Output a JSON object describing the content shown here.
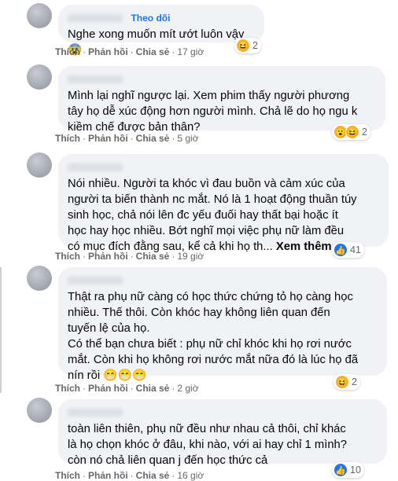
{
  "comments": [
    {
      "follow_label": "Theo dõi",
      "text": "Nghe xong muốn mít ướt luôn vậy 😨",
      "actions": {
        "like": "Thích",
        "reply": "Phản hồi",
        "share": "Chia sẻ",
        "time": "17 giờ"
      },
      "reactions": {
        "icons": [
          "haha-icon"
        ],
        "count": "2"
      }
    },
    {
      "text": "Mình lại nghĩ ngược lại. Xem phim thấy người phương\ntây họ dễ xúc động hơn người mình. Chả lẽ do họ ngu k\nkiềm chế được bản thân?",
      "actions": {
        "like": "Thích",
        "reply": "Phản hồi",
        "share": "Chia sẻ",
        "time": "5 giờ"
      },
      "reactions": {
        "icons": [
          "wow-icon",
          "haha-icon"
        ],
        "count": "2"
      }
    },
    {
      "text": "Nói nhiều. Người ta khóc vì đau buồn và cảm xúc của\nngười ta biến thành nc mắt. Nó là 1 hoạt động thuần túy\nsinh học, chả nói lên đc yếu đuối hay thất bại hoặc ít\nhọc hay học nhiều. Bớt nghĩ mọi việc phụ nữ làm đều\ncó mục đích đằng sau, kể cả khi họ th...",
      "see_more": "Xem thêm",
      "actions": {
        "like": "Thích",
        "reply": "Phản hồi",
        "share": "Chia sẻ",
        "time": "19 giờ"
      },
      "reactions": {
        "icons": [
          "like-icon"
        ],
        "count": "41"
      }
    },
    {
      "text": "Thật ra phụ nữ càng có học thức chứng tỏ họ càng học\nnhiều. Thế thôi. Còn khóc hay không liên quan đến\ntuyến lệ của họ.\nCó thể bạn chưa biết : phụ nữ chỉ khóc khi họ rơi nước\nmắt. Còn khi họ không rơi nước mắt nữa đó là lúc họ đã\nnín rồi",
      "trailing_emoji": "😁😁😁",
      "actions": {
        "like": "Thích",
        "reply": "Phản hồi",
        "share": "Chia sẻ",
        "time": "2 giờ"
      },
      "reactions": {
        "icons": [
          "haha-icon"
        ],
        "count": "2"
      }
    },
    {
      "text": "toàn liên thiên, phụ nữ đều như nhau cả thôi, chỉ khác\nlà họ chọn khóc ở đâu, khi nào, với ai hay chỉ 1 mình?\ncòn nó chả liên quan j đến học thức cả",
      "actions": {
        "like": "Thích",
        "reply": "Phản hồi",
        "share": "Chia sẻ",
        "time": "16 giờ"
      },
      "reactions": {
        "icons": [
          "like-icon"
        ],
        "count": "10"
      }
    }
  ],
  "separator": "·"
}
